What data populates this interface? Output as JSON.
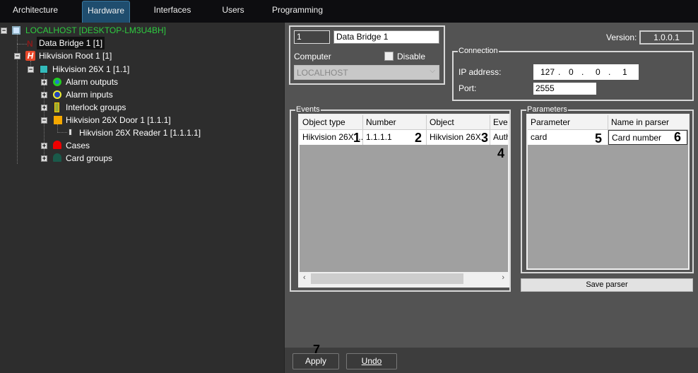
{
  "tabs": [
    {
      "label": "Architecture"
    },
    {
      "label": "Hardware"
    },
    {
      "label": "Interfaces"
    },
    {
      "label": "Users"
    },
    {
      "label": "Programming"
    }
  ],
  "tree": {
    "root": "LOCALHOST [DESKTOP-LM3U4BH]",
    "data_bridge": "Data Bridge 1 [1]",
    "hik_root": "Hikvision Root 1 [1]",
    "hik_device": "Hikvision 26X 1 [1.1]",
    "alarm_outputs": "Alarm outputs",
    "alarm_inputs": "Alarm inputs",
    "interlock": "Interlock groups",
    "door": "Hikvision 26X Door 1 [1.1.1]",
    "reader": "Hikvision 26X Reader 1 [1.1.1.1]",
    "cases": "Cases",
    "card_groups": "Card groups"
  },
  "object": {
    "id": "1",
    "name": "Data Bridge 1",
    "computer_label": "Computer",
    "computer_value": "LOCALHOST",
    "disable_label": "Disable",
    "version_label": "Version:",
    "version": "1.0.0.1"
  },
  "connection": {
    "title": "Connection",
    "ip_label": "IP address:",
    "ip": [
      "127",
      "0",
      "0",
      "1"
    ],
    "port_label": "Port:",
    "port": "2555"
  },
  "events": {
    "title": "Events",
    "columns": [
      "Object type",
      "Number",
      "Object",
      "Ever"
    ],
    "rows": [
      [
        "Hikvision 26X ...",
        "1.1.1.1",
        "Hikvision 26X",
        "Auth"
      ]
    ]
  },
  "parameters": {
    "title": "Parameters",
    "columns": [
      "Parameter",
      "Name in parser"
    ],
    "rows": [
      [
        "card",
        "Card number"
      ]
    ],
    "save_label": "Save parser"
  },
  "callouts": [
    "1",
    "2",
    "3",
    "4",
    "5",
    "6",
    "7"
  ],
  "footer": {
    "apply": "Apply",
    "undo": "Undo"
  },
  "colors": {
    "accent": "#1f4d6e",
    "root_green": "#2ecc40"
  }
}
